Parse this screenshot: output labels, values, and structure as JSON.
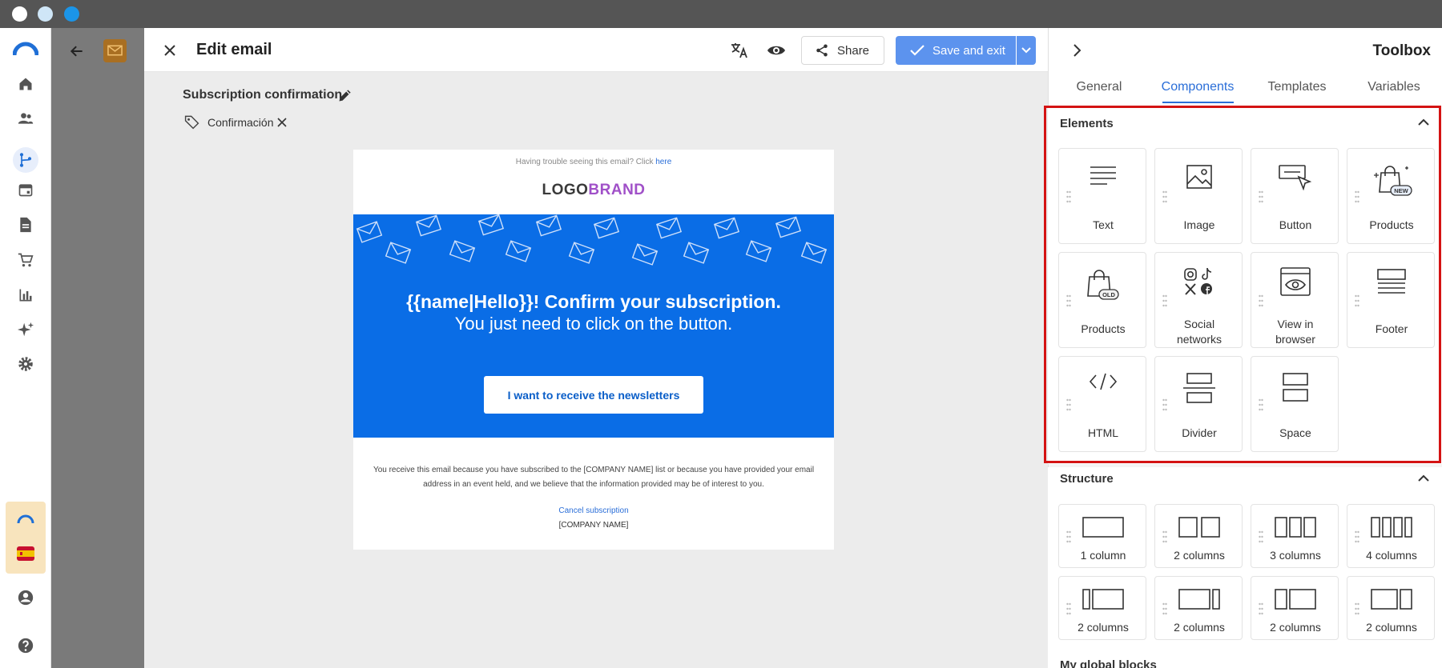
{
  "colors": {
    "accent": "#2a6ed8",
    "save_button": "#5c93ee",
    "hero_bg": "#0a6de6",
    "highlight": "#d41313",
    "logo_dark": "#3a3a3a",
    "logo_brand": "#a050c8"
  },
  "editor": {
    "title": "Edit email",
    "share_label": "Share",
    "save_label": "Save and exit",
    "subject": "Subscription confirmation",
    "tag": "Confirmación"
  },
  "email": {
    "trouble_text": "Having trouble seeing this email? Click ",
    "trouble_link": "here",
    "logo_part1": "LOGO",
    "logo_part2": "BRAND",
    "headline": "{{name|Hello}}! Confirm your subscription.",
    "subheadline": "You just need to click on the button.",
    "cta": "I want to receive the newsletters",
    "footer_text": "You receive this email because you have subscribed to the [COMPANY NAME] list or because you have provided your email address in an event held, and we believe that the information provided may be of interest to you.",
    "cancel_link": "Cancel subscription",
    "company": "[COMPANY NAME]"
  },
  "toolbox": {
    "title": "Toolbox",
    "tabs": [
      {
        "label": "General",
        "active": false
      },
      {
        "label": "Components",
        "active": true
      },
      {
        "label": "Templates",
        "active": false
      },
      {
        "label": "Variables",
        "active": false
      }
    ],
    "elements_title": "Elements",
    "elements": [
      {
        "label": "Text",
        "icon": "text-icon"
      },
      {
        "label": "Image",
        "icon": "image-icon"
      },
      {
        "label": "Button",
        "icon": "button-icon"
      },
      {
        "label": "Products",
        "icon": "products-new-icon",
        "badge": "NEW"
      },
      {
        "label": "Products",
        "icon": "products-old-icon",
        "badge": "OLD"
      },
      {
        "label": "Social networks",
        "icon": "social-networks-icon"
      },
      {
        "label": "View in browser",
        "icon": "view-in-browser-icon"
      },
      {
        "label": "Footer",
        "icon": "footer-icon"
      },
      {
        "label": "HTML",
        "icon": "html-icon"
      },
      {
        "label": "Divider",
        "icon": "divider-icon"
      },
      {
        "label": "Space",
        "icon": "space-icon"
      }
    ],
    "structure_title": "Structure",
    "structure": [
      {
        "label": "1 column",
        "icon": "one-column-icon"
      },
      {
        "label": "2 columns",
        "icon": "two-columns-icon"
      },
      {
        "label": "3 columns",
        "icon": "three-columns-icon"
      },
      {
        "label": "4 columns",
        "icon": "four-columns-icon"
      },
      {
        "label": "2 columns",
        "icon": "two-columns-narrow-wide-icon"
      },
      {
        "label": "2 columns",
        "icon": "two-columns-wide-narrow-icon"
      },
      {
        "label": "2 columns",
        "icon": "two-columns-third-icon"
      },
      {
        "label": "2 columns",
        "icon": "two-columns-two-thirds-icon"
      }
    ],
    "global_blocks_title": "My global blocks"
  }
}
